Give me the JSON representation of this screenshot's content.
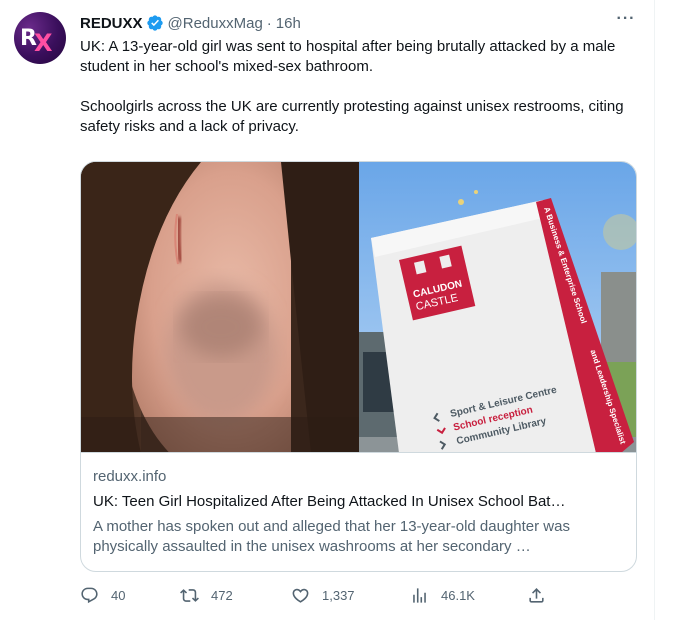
{
  "account": {
    "name": "REDUXX",
    "handle": "@ReduxxMag",
    "separator": "·",
    "time": "16h",
    "avatar_letters": "RX"
  },
  "tweet": {
    "para1": "UK: A 13-year-old girl was sent to hospital after being brutally attacked by a male student in her school's mixed-sex bathroom.",
    "para2": "Schoolgirls across the UK are currently protesting against unisex restrooms, citing safety risks and a lack of privacy."
  },
  "card": {
    "domain": "reduxx.info",
    "title": "UK: Teen Girl Hospitalized After Being Attacked In Unisex School Bat…",
    "description": "A mother has spoken out and alleged that her 13-year-old daughter was physically assaulted in the unisex washrooms at her secondary …",
    "sign": {
      "logo_line1": "CALUDON",
      "logo_line2": "CASTLE",
      "side_text": "A Business & Enterprise School",
      "side_text2": "and Leadership Specialist",
      "line1": "Sport & Leisure Centre",
      "line2": "School reception",
      "line3": "Community Library"
    }
  },
  "actions": {
    "replies": "40",
    "reposts": "472",
    "likes": "1,337",
    "views": "46.1K"
  },
  "icons": {
    "verified": "verified-badge-icon",
    "more": "more-icon",
    "reply": "reply-icon",
    "repost": "repost-icon",
    "like": "heart-icon",
    "views": "views-icon",
    "share": "share-icon"
  },
  "colors": {
    "accent": "#1d9bf0",
    "text": "#0f1419",
    "secondary": "#536471",
    "sign_red": "#c8203f"
  }
}
